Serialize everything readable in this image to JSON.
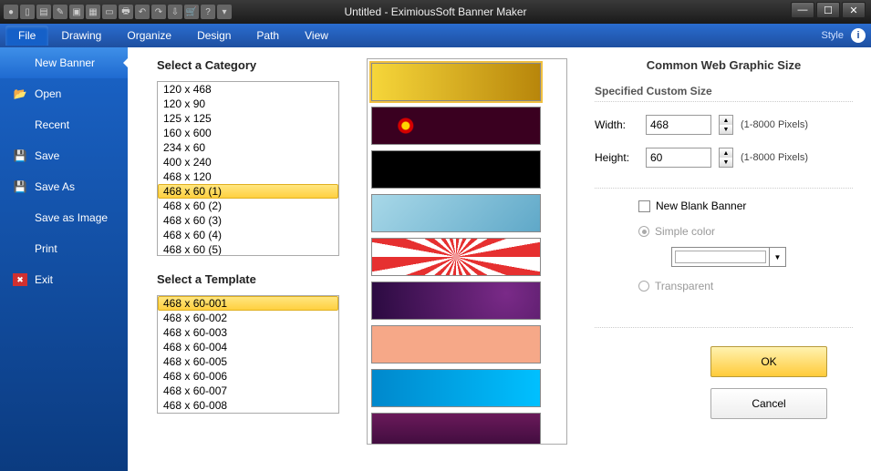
{
  "window": {
    "title": "Untitled - EximiousSoft Banner Maker"
  },
  "menubar": {
    "tabs": [
      "File",
      "Drawing",
      "Organize",
      "Design",
      "Path",
      "View"
    ],
    "active": 0,
    "style_label": "Style"
  },
  "sidebar": {
    "items": [
      {
        "label": "New Banner",
        "icon": ""
      },
      {
        "label": "Open",
        "icon": "folder"
      },
      {
        "label": "Recent",
        "icon": ""
      },
      {
        "label": "Save",
        "icon": "disk"
      },
      {
        "label": "Save As",
        "icon": "disk"
      },
      {
        "label": "Save as Image",
        "icon": ""
      },
      {
        "label": "Print",
        "icon": ""
      },
      {
        "label": "Exit",
        "icon": "x"
      }
    ],
    "selected": 0
  },
  "category": {
    "label": "Select a Category",
    "items": [
      "120 x 468",
      "120 x 90",
      "125 x 125",
      "160 x 600",
      "234 x 60",
      "400 x 240",
      "468 x 120",
      "468 x 60 (1)",
      "468 x 60 (2)",
      "468 x 60 (3)",
      "468 x 60 (4)",
      "468 x 60 (5)"
    ],
    "selected": 7
  },
  "template": {
    "label": "Select a Template",
    "items": [
      "468 x 60-001",
      "468 x 60-002",
      "468 x 60-003",
      "468 x 60-004",
      "468 x 60-005",
      "468 x 60-006",
      "468 x 60-007",
      "468 x 60-008"
    ],
    "selected": 0
  },
  "right": {
    "title": "Common Web Graphic Size",
    "sub_title": "Specified Custom Size",
    "width_label": "Width:",
    "width_value": "468",
    "height_label": "Height:",
    "height_value": "60",
    "range_hint": "(1-8000 Pixels)",
    "blank_label": "New Blank Banner",
    "simple_label": "Simple color",
    "transparent_label": "Transparent",
    "ok_label": "OK",
    "cancel_label": "Cancel"
  },
  "thumbs": [
    {
      "bg": "linear-gradient(90deg,#f6d63a,#b8860b)"
    },
    {
      "bg": "radial-gradient(circle at 20% 50%, #ffd500 4px, #d40000 5px 8px, #3a0020 9px), #3a0020"
    },
    {
      "bg": "#000"
    },
    {
      "bg": "linear-gradient(135deg,#a8d8e8,#5fa8c8)"
    },
    {
      "bg": "repeating-conic-gradient(from 0deg at 50% 50%, #e63030 0 10deg, #fff 10deg 20deg)"
    },
    {
      "bg": "radial-gradient(circle at 80% 30%, #7a2a88, #2a0a40)"
    },
    {
      "bg": "#f6a888"
    },
    {
      "bg": "linear-gradient(90deg,#0088cc,#00c0ff)"
    },
    {
      "bg": "linear-gradient(#6a1a5a,#3a0a3a)"
    }
  ]
}
